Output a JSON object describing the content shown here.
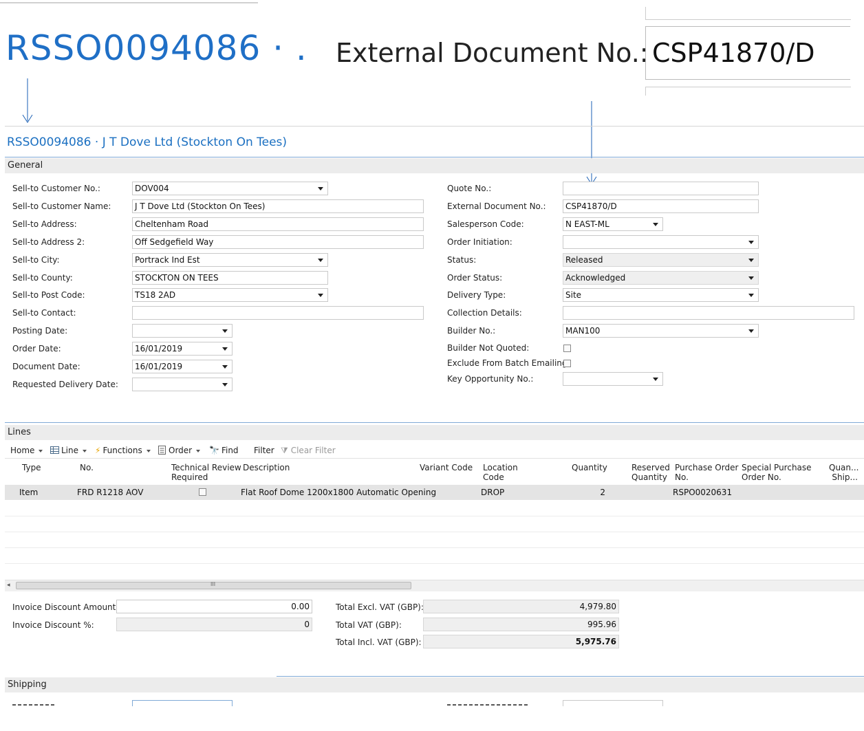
{
  "zoom": {
    "order_no": "RSSO0094086 · .",
    "ext_label": "External Document No.:",
    "ext_value": "CSP41870/D"
  },
  "header": {
    "title": "RSSO0094086 · J T Dove Ltd (Stockton On Tees)"
  },
  "general": {
    "section_label": "General",
    "sell_to_customer_no": {
      "label": "Sell-to Customer No.:",
      "value": "DOV004"
    },
    "sell_to_customer_name": {
      "label": "Sell-to Customer Name:",
      "value": "J T Dove Ltd (Stockton On Tees)"
    },
    "sell_to_address": {
      "label": "Sell-to Address:",
      "value": "Cheltenham Road"
    },
    "sell_to_address2": {
      "label": "Sell-to Address 2:",
      "value": "Off Sedgefield Way"
    },
    "sell_to_city": {
      "label": "Sell-to City:",
      "value": "Portrack Ind Est"
    },
    "sell_to_county": {
      "label": "Sell-to County:",
      "value": "STOCKTON ON TEES"
    },
    "sell_to_post_code": {
      "label": "Sell-to Post Code:",
      "value": "TS18 2AD"
    },
    "sell_to_contact": {
      "label": "Sell-to Contact:",
      "value": ""
    },
    "posting_date": {
      "label": "Posting Date:",
      "value": ""
    },
    "order_date": {
      "label": "Order Date:",
      "value": "16/01/2019"
    },
    "document_date": {
      "label": "Document Date:",
      "value": "16/01/2019"
    },
    "requested_delivery_date": {
      "label": "Requested Delivery Date:",
      "value": ""
    },
    "quote_no": {
      "label": "Quote No.:",
      "value": ""
    },
    "external_document_no": {
      "label": "External Document No.:",
      "value": "CSP41870/D"
    },
    "salesperson_code": {
      "label": "Salesperson Code:",
      "value": "N EAST-ML"
    },
    "order_initiation": {
      "label": "Order Initiation:",
      "value": ""
    },
    "status": {
      "label": "Status:",
      "value": "Released"
    },
    "order_status": {
      "label": "Order Status:",
      "value": "Acknowledged"
    },
    "delivery_type": {
      "label": "Delivery Type:",
      "value": "Site"
    },
    "collection_details": {
      "label": "Collection Details:",
      "value": ""
    },
    "builder_no": {
      "label": "Builder No.:",
      "value": "MAN100"
    },
    "builder_not_quoted": {
      "label": "Builder Not Quoted:"
    },
    "exclude_batch": {
      "label": "Exclude From Batch Emailing:"
    },
    "key_opportunity_no": {
      "label": "Key Opportunity No.:",
      "value": ""
    }
  },
  "lines": {
    "section_label": "Lines",
    "toolbar": {
      "home": "Home",
      "line": "Line",
      "functions": "Functions",
      "order": "Order",
      "find": "Find",
      "filter": "Filter",
      "clear_filter": "Clear Filter"
    },
    "columns": {
      "type": "Type",
      "no": "No.",
      "tech_review_1": "Technical Review",
      "tech_review_2": "Required",
      "description": "Description",
      "variant_code": "Variant Code",
      "location_1": "Location",
      "location_2": "Code",
      "quantity": "Quantity",
      "reserved_1": "Reserved",
      "reserved_2": "Quantity",
      "po_1": "Purchase Order",
      "po_2": "No.",
      "spo_1": "Special Purchase",
      "spo_2": "Order No.",
      "qship_1": "Quan...",
      "qship_2": "Ship..."
    },
    "row": {
      "type": "Item",
      "no": "FRD R1218 AOV",
      "description": "Flat Roof Dome 1200x1800 Automatic Opening",
      "location": "DROP",
      "quantity": "2",
      "purchase_order_no": "RSPO0020631"
    },
    "scroll_grip": "III"
  },
  "totals": {
    "invoice_discount_amount": {
      "label": "Invoice Discount Amount:",
      "value": "0.00"
    },
    "invoice_discount_pct": {
      "label": "Invoice Discount %:",
      "value": "0"
    },
    "total_excl_vat": {
      "label": "Total Excl. VAT (GBP):",
      "value": "4,979.80"
    },
    "total_vat": {
      "label": "Total VAT (GBP):",
      "value": "995.96"
    },
    "total_incl_vat": {
      "label": "Total Incl. VAT (GBP):",
      "value": "5,975.76"
    }
  },
  "shipping": {
    "section_label": "Shipping"
  },
  "colors": {
    "accent": "#1a6fc1",
    "divider": "#7fa9d6",
    "section_bg": "#ececec"
  }
}
